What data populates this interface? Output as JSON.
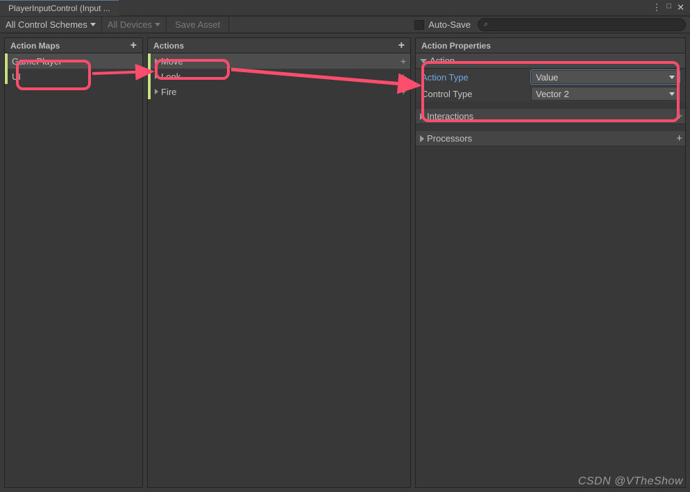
{
  "window": {
    "tab_title": "PlayerInputControl (Input ..."
  },
  "toolbar": {
    "schemes": "All Control Schemes",
    "devices": "All Devices",
    "save_asset": "Save Asset",
    "auto_save": "Auto-Save",
    "search_placeholder": ""
  },
  "columns": {
    "action_maps": {
      "title": "Action Maps",
      "items": [
        "GamePlayer",
        "UI"
      ]
    },
    "actions": {
      "title": "Actions",
      "items": [
        "Move",
        "Look",
        "Fire"
      ]
    },
    "props": {
      "title": "Action Properties",
      "action_header": "Action",
      "action_type_label": "Action Type",
      "action_type_value": "Value",
      "control_type_label": "Control Type",
      "control_type_value": "Vector 2",
      "interactions_header": "Interactions",
      "processors_header": "Processors"
    }
  },
  "watermark": "CSDN @VTheShow"
}
